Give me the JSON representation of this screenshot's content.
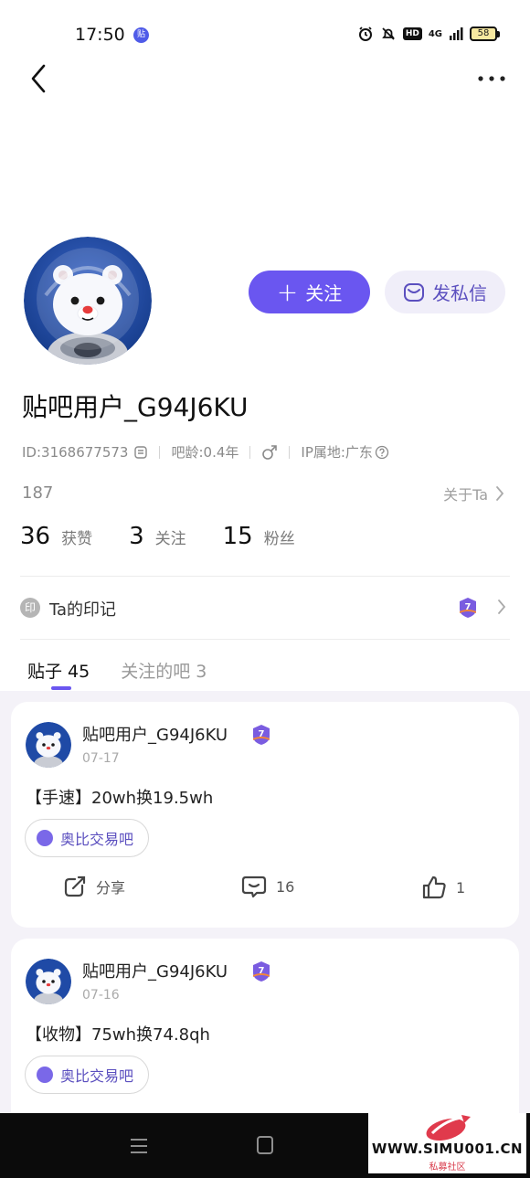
{
  "status_bar": {
    "time": "17:50",
    "app_badge": "贴",
    "network": "4G",
    "battery": "58"
  },
  "icons": {
    "back": "chevron-left-icon",
    "more": "more-horizontal-icon",
    "message": "envelope-icon",
    "help": "question-circle-icon",
    "gender": "male-icon",
    "copy": "copy-icon",
    "share": "share-icon",
    "comment": "comment-icon",
    "like": "thumbs-up-icon"
  },
  "colors": {
    "accent": "#6a56f0",
    "accent_soft": "#f0eef9",
    "feed_bg": "#f4f2f8",
    "badge_purple": "#7a5ce0",
    "badge_orange": "#f2853a"
  },
  "profile": {
    "username": "贴吧用户_G94J6KU",
    "id_text": "ID:3168677573",
    "age_text": "吧龄:0.4年",
    "ip_text": "IP属地:广东",
    "bio": "187",
    "about_label": "关于Ta",
    "follow_label": "关注",
    "message_label": "发私信",
    "level": "7"
  },
  "stats": [
    {
      "count": "36",
      "label": "获赞"
    },
    {
      "count": "3",
      "label": "关注"
    },
    {
      "count": "15",
      "label": "粉丝"
    }
  ],
  "marks": {
    "icon_text": "印",
    "label": "Ta的印记"
  },
  "tabs": [
    {
      "label": "贴子 45",
      "active": true
    },
    {
      "label": "关注的吧 3",
      "active": false
    }
  ],
  "posts": [
    {
      "author": "贴吧用户_G94J6KU",
      "date": "07-17",
      "title": "【手速】20wh换19.5wh",
      "forum": "奥比交易吧",
      "share_label": "分享",
      "comments": "16",
      "likes": "1"
    },
    {
      "author": "贴吧用户_G94J6KU",
      "date": "07-16",
      "title": "【收物】75wh换74.8qh",
      "forum": "奥比交易吧"
    }
  ],
  "watermark": {
    "text": "WWW.SIMU001.CN",
    "sub": "私募社区"
  }
}
